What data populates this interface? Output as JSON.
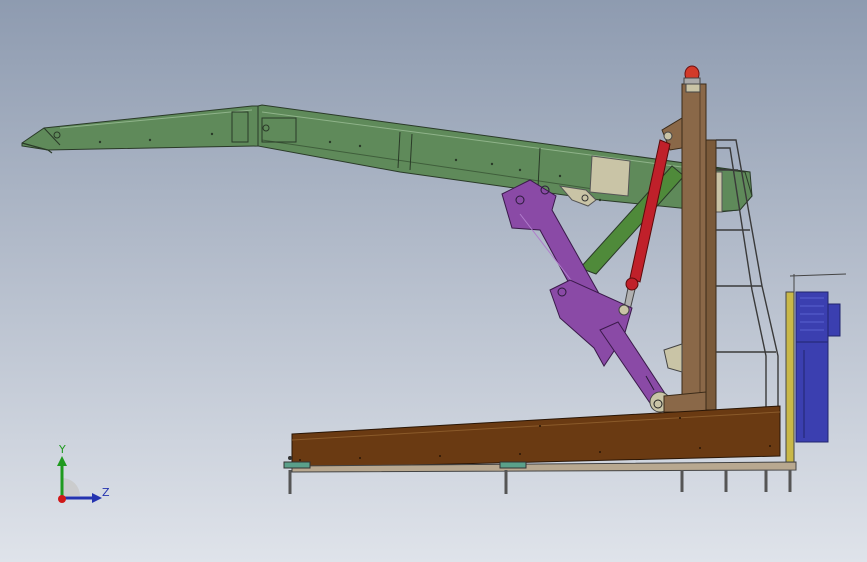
{
  "viewport": {
    "background_top": "#8e9bb0",
    "background_bottom": "#dfe3ea"
  },
  "triad": {
    "y_label": "Y",
    "z_label": "Z",
    "y_color": "#1f9a1f",
    "z_color": "#2433b0",
    "origin_color": "#d01818"
  },
  "model": {
    "boom_color": "#5f8a5a",
    "boom_dark": "#3f5e3b",
    "arm_color": "#8a4aa6",
    "arm_dark": "#5a2a70",
    "column_color": "#8a6848",
    "column_dark": "#5b4128",
    "base_color": "#6a3a12",
    "base_dark": "#3e2208",
    "cylinder_color": "#c0202a",
    "brace_color": "#4f8a3a",
    "motor_color": "#3b3fb0",
    "motor_dark": "#22266e",
    "plate_color": "#c9c4a6",
    "beacon_color": "#d23a2a"
  }
}
